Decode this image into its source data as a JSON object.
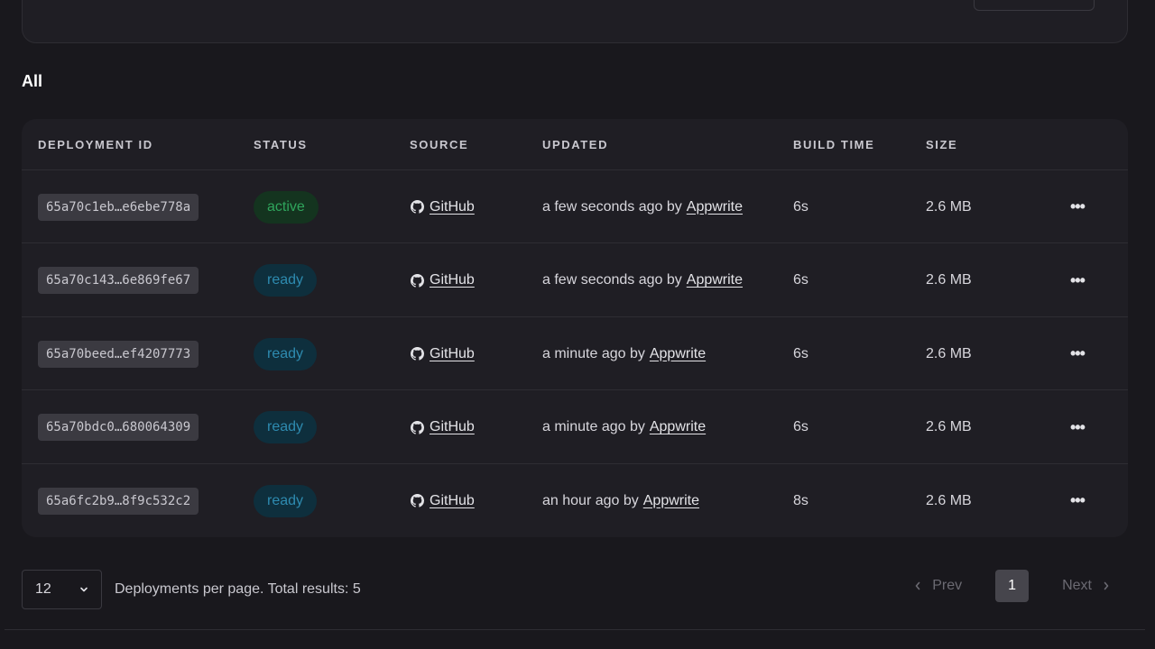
{
  "section": {
    "title": "All"
  },
  "columns": {
    "deployment_id": "DEPLOYMENT ID",
    "status": "STATUS",
    "source": "SOURCE",
    "updated": "UPDATED",
    "build_time": "BUILD TIME",
    "size": "SIZE"
  },
  "rows": [
    {
      "id": "65a70c1eb…e6ebe778a",
      "status": "active",
      "source": "GitHub",
      "updated": "a few seconds ago by",
      "user": "Appwrite",
      "build_time": "6s",
      "size": "2.6 MB"
    },
    {
      "id": "65a70c143…6e869fe67",
      "status": "ready",
      "source": "GitHub",
      "updated": "a few seconds ago by",
      "user": "Appwrite",
      "build_time": "6s",
      "size": "2.6 MB"
    },
    {
      "id": "65a70beed…ef4207773",
      "status": "ready",
      "source": "GitHub",
      "updated": "a minute ago by",
      "user": "Appwrite",
      "build_time": "6s",
      "size": "2.6 MB"
    },
    {
      "id": "65a70bdc0…680064309",
      "status": "ready",
      "source": "GitHub",
      "updated": "a minute ago by",
      "user": "Appwrite",
      "build_time": "6s",
      "size": "2.6 MB"
    },
    {
      "id": "65a6fc2b9…8f9c532c2",
      "status": "ready",
      "source": "GitHub",
      "updated": "an hour ago by",
      "user": "Appwrite",
      "build_time": "8s",
      "size": "2.6 MB"
    }
  ],
  "row_action_icon": "more-horizontal-icon",
  "footer": {
    "per_page_value": "12",
    "per_page_text": "Deployments per page. Total results: 5",
    "prev_label": "Prev",
    "next_label": "Next",
    "current_page": "1"
  },
  "colors": {
    "background": "#19181d",
    "card": "#1f1e24",
    "active_bg": "#14341f",
    "active_text": "#2fa55c",
    "ready_bg": "#0e2f3d",
    "ready_text": "#2e8bb0"
  }
}
